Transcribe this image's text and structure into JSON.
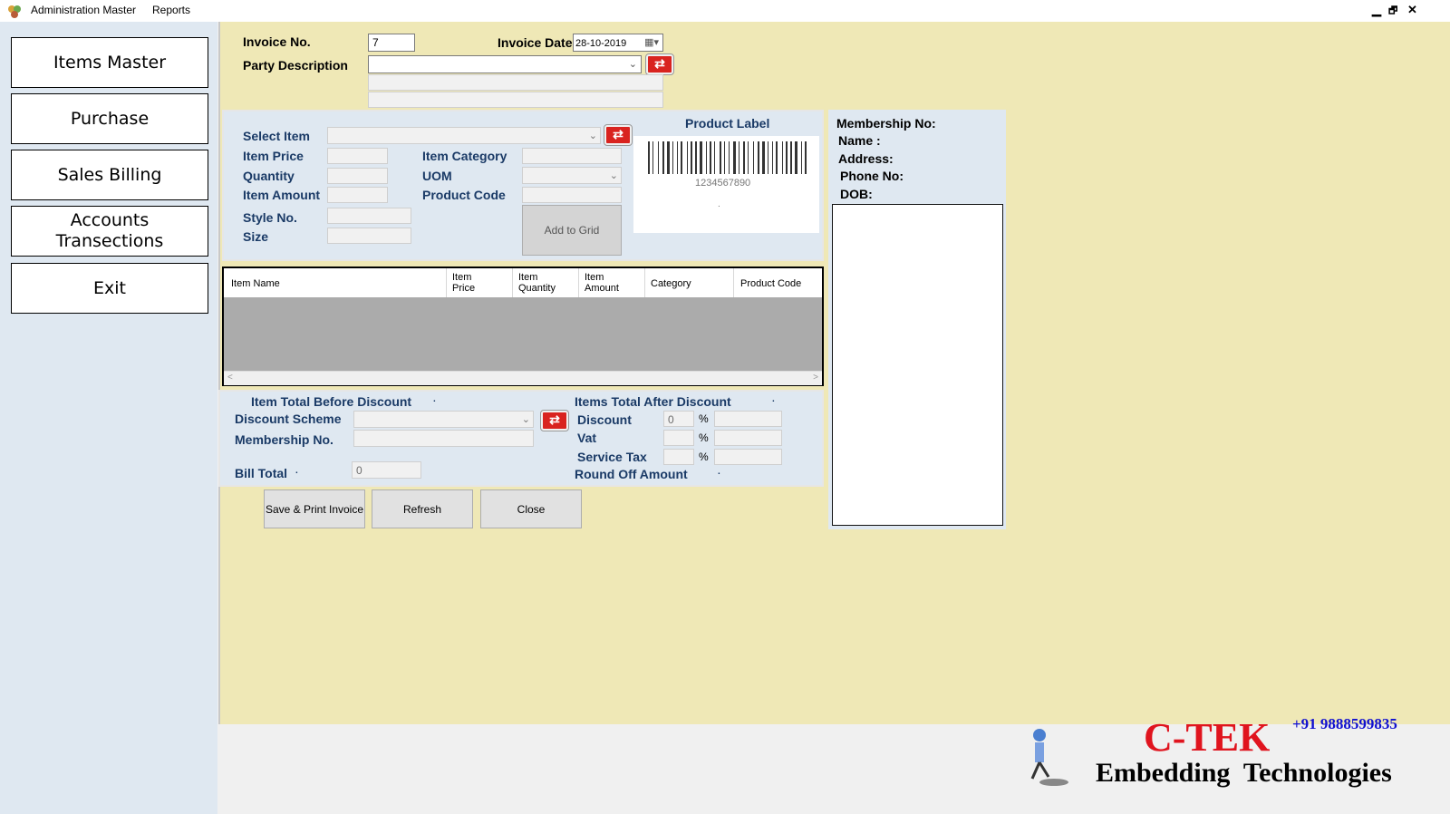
{
  "menubar": {
    "items": [
      "Administration Master",
      "Reports"
    ],
    "window_controls": [
      "▁",
      "🗗",
      "✕"
    ]
  },
  "sidebar": {
    "items": [
      "Items Master",
      "Purchase",
      "Sales Billing",
      "Accounts\nTransections",
      "Exit"
    ]
  },
  "header": {
    "invoice_no_label": "Invoice No.",
    "invoice_no_value": "7",
    "invoice_date_label": "Invoice Date",
    "invoice_date_value": "28-10-2019",
    "party_description_label": "Party Description"
  },
  "item_panel": {
    "select_item_label": "Select Item",
    "item_price_label": "Item Price",
    "quantity_label": "Quantity",
    "item_amount_label": "Item Amount",
    "style_no_label": "Style No.",
    "size_label": "Size",
    "item_category_label": "Item  Category",
    "uom_label": "UOM",
    "product_code_label": "Product Code",
    "add_to_grid_label": "Add to Grid",
    "product_label_title": "Product Label",
    "barcode_number": "1234567890",
    "barcode_dot": "."
  },
  "grid": {
    "columns": [
      "Item Name",
      "Item\nPrice",
      "Item\nQuantity",
      "Item\nAmount",
      "Category",
      "Product Code"
    ],
    "scroll_left": "<",
    "scroll_right": ">"
  },
  "totals": {
    "item_total_before_label": "Item Total Before Discount",
    "item_total_before_value": ".",
    "items_total_after_label": "Items Total After Discount",
    "items_total_after_value": ".",
    "discount_scheme_label": "Discount Scheme",
    "membership_no_label": "Membership No.",
    "bill_total_label": "Bill Total",
    "bill_total_dot": ".",
    "bill_total_value": "0",
    "discount_label": "Discount",
    "discount_value": "0",
    "vat_label": "Vat",
    "service_tax_label": "Service Tax",
    "round_off_label": "Round Off Amount",
    "round_off_value": ".",
    "percent": "%"
  },
  "actions": {
    "save_print": "Save & Print Invoice",
    "refresh": "Refresh",
    "close": "Close"
  },
  "member": {
    "membership_no_label": "Membership No:",
    "name_label": "Name :",
    "address_label": "Address:",
    "phone_label": "Phone No:",
    "dob_label": "DOB:"
  },
  "branding": {
    "phone": "+91 9888599835",
    "company": "C-TEK",
    "tagline": "Embedding  Technologies",
    "accent_red": "#e0141e",
    "accent_blue": "#1010d0"
  },
  "icons": {
    "app": "app-logo-icon",
    "sync": "refresh-arrows-icon",
    "calendar": "calendar-icon",
    "robot": "robot-mascot-icon"
  }
}
